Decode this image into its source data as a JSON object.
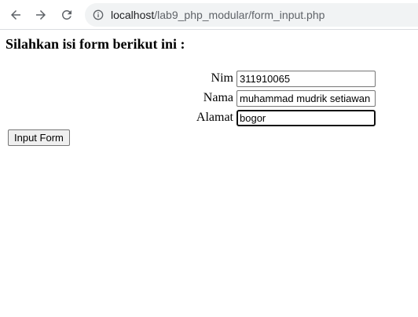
{
  "browser": {
    "url_host": "localhost",
    "url_path": "/lab9_php_modular/form_input.php"
  },
  "page": {
    "title": "Silahkan isi form berikut ini :"
  },
  "form": {
    "fields": [
      {
        "label": "Nim",
        "value": "311910065"
      },
      {
        "label": "Nama",
        "value": "muhammad mudrik setiawan"
      },
      {
        "label": "Alamat",
        "value": "bogor"
      }
    ],
    "submit_label": "Input Form"
  },
  "colors": {
    "toolbar_icon": "#5f6368",
    "omnibox_bg": "#f1f3f4"
  }
}
